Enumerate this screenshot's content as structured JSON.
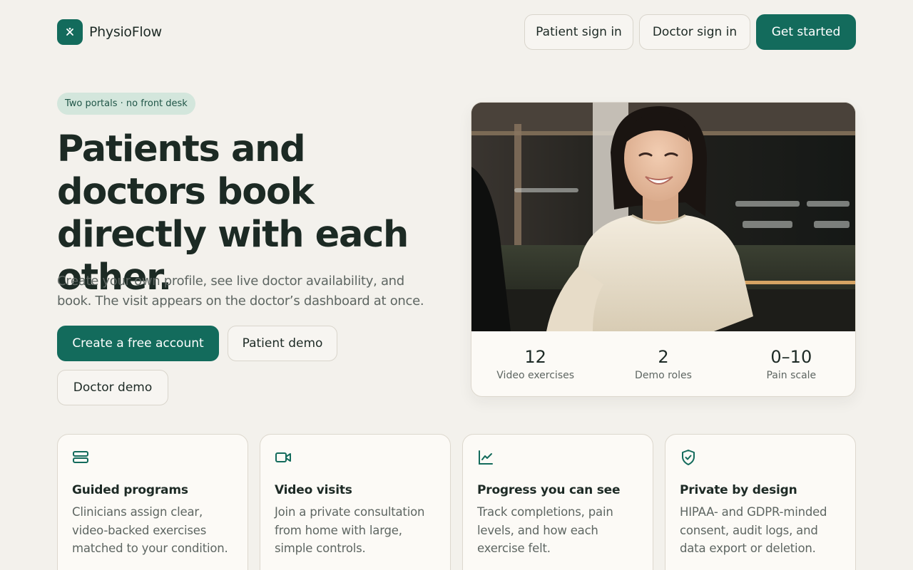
{
  "header": {
    "brand_name": "PhysioFlow",
    "nav": {
      "patient_sign_in": "Patient sign in",
      "doctor_sign_in": "Doctor sign in",
      "get_started": "Get started"
    }
  },
  "hero": {
    "badge": "Two portals · no front desk",
    "headline": "Patients and doctors book directly with each other.",
    "subtext": "Create your own profile, see live doctor availability, and book. The visit appears on the doctor’s dashboard at once.",
    "buttons": {
      "create_account": "Create a free account",
      "patient_demo": "Patient demo",
      "doctor_demo": "Doctor demo"
    }
  },
  "stats": [
    {
      "value": "12",
      "label": "Video exercises"
    },
    {
      "value": "2",
      "label": "Demo roles"
    },
    {
      "value": "0–10",
      "label": "Pain scale"
    }
  ],
  "features": [
    {
      "icon": "layers-icon",
      "title": "Guided programs",
      "description": "Clinicians assign clear, video-backed exercises matched to your condition."
    },
    {
      "icon": "video-icon",
      "title": "Video visits",
      "description": "Join a private consultation from home with large, simple controls."
    },
    {
      "icon": "chart-icon",
      "title": "Progress you can see",
      "description": "Track completions, pain levels, and how each exercise felt."
    },
    {
      "icon": "shield-check-icon",
      "title": "Private by design",
      "description": "HIPAA- and GDPR-minded consent, audit logs, and data export or deletion."
    }
  ],
  "colors": {
    "brand": "#136b5c",
    "background": "#f3f1ec",
    "badge_bg": "#d3e6dc",
    "card_bg": "#fcfaf6"
  }
}
